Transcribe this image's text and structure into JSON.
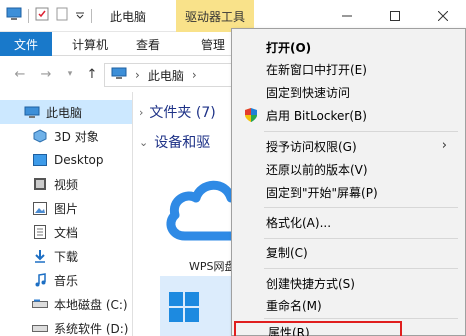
{
  "titlebar": {
    "title": "此电脑",
    "contextual_tab": "驱动器工具"
  },
  "ribbon": {
    "tabs": [
      "文件",
      "计算机",
      "查看",
      "管理"
    ]
  },
  "address": {
    "path": "此电脑"
  },
  "sidebar": {
    "items": [
      {
        "label": "此电脑",
        "icon": "computer-icon"
      },
      {
        "label": "3D 对象",
        "icon": "3d-objects-icon"
      },
      {
        "label": "Desktop",
        "icon": "desktop-icon"
      },
      {
        "label": "视频",
        "icon": "video-icon"
      },
      {
        "label": "图片",
        "icon": "pictures-icon"
      },
      {
        "label": "文档",
        "icon": "documents-icon"
      },
      {
        "label": "下载",
        "icon": "downloads-icon"
      },
      {
        "label": "音乐",
        "icon": "music-icon"
      },
      {
        "label": "本地磁盘 (C:)",
        "icon": "drive-icon"
      },
      {
        "label": "系统软件 (D:)",
        "icon": "drive-icon"
      }
    ]
  },
  "content": {
    "folders_header": "文件夹 (7)",
    "devices_header": "设备和驱",
    "wps_label": "WPS网盘"
  },
  "context_menu": {
    "items": [
      {
        "label": "打开(O)",
        "bold": true
      },
      {
        "label": "在新窗口中打开(E)"
      },
      {
        "label": "固定到快速访问"
      },
      {
        "label": "启用 BitLocker(B)",
        "icon": "shield-icon"
      },
      {
        "label": "授予访问权限(G)",
        "submenu": true
      },
      {
        "label": "还原以前的版本(V)"
      },
      {
        "label": "固定到\"开始\"屏幕(P)"
      },
      {
        "label": "格式化(A)..."
      },
      {
        "label": "复制(C)"
      },
      {
        "label": "创建快捷方式(S)"
      },
      {
        "label": "重命名(M)"
      },
      {
        "label": "属性(R)",
        "highlighted": true
      }
    ]
  },
  "colors": {
    "accent": "#1979ca",
    "contextual_tab_bg": "#f9e28a",
    "highlight_outline": "#e01e1e",
    "menu_bg": "#f2f2f2",
    "selected_nav": "#cce8ff"
  }
}
